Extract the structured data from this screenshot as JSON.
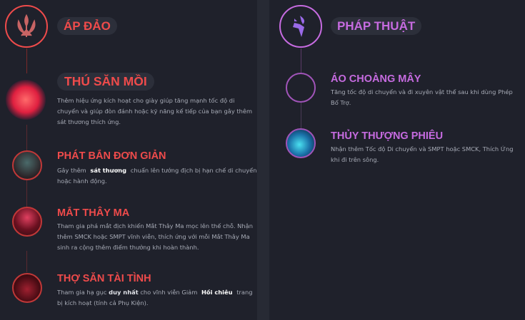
{
  "colors": {
    "domination": "#ef4b4b",
    "sorcery": "#c66be0",
    "text": "#a7abb6",
    "bg": "#1f212b"
  },
  "left": {
    "tree_name": "ÁP ĐẢO",
    "tree_icon": "domination-crest-icon",
    "keystone": {
      "name": "THÚ SĂN MỒI",
      "icon": "wolf-icon",
      "desc": "Thêm hiệu ứng kích hoạt cho giày giúp tăng mạnh tốc độ di chuyển và giúp đòn đánh hoặc kỹ năng kế tiếp của bạn gây thêm sát thương thích ứng."
    },
    "runes": [
      {
        "name": "PHÁT BẮN ĐƠN GIẢN",
        "icon": "cheap-shot-icon",
        "desc_a": "Gây thêm",
        "desc_b": "sát thương",
        "desc_c": "chuẩn lên tướng địch bị hạn chế di chuyển hoặc hành động."
      },
      {
        "name": "MẮT THÂY MA",
        "icon": "zombie-ward-icon",
        "desc": "Tham gia phá mắt địch khiến Mắt Thây Ma mọc lên thế chỗ. Nhận thêm SMCK hoặc SMPT vĩnh viễn, thích ứng với mỗi Mắt Thây Ma sinh ra cộng thêm điểm thưởng khi hoàn thành."
      },
      {
        "name": "THỢ SĂN TÀI TÌNH",
        "icon": "ingenious-hunter-icon",
        "desc_a": "Tham gia hạ gục",
        "desc_b": "duy nhất",
        "desc_c": "cho vĩnh viễn Giảm",
        "desc_d": "Hồi chiêu",
        "desc_e": "trang bị kích hoạt (tính cả Phụ Kiện)."
      }
    ]
  },
  "right": {
    "tree_name": "PHÁP THUẬT",
    "tree_icon": "sorcery-shard-icon",
    "runes": [
      {
        "name": "ÁO CHOÀNG MÂY",
        "icon": "nimbus-cloak-icon",
        "desc": "Tăng tốc độ di chuyển và đi xuyên vật thể sau khi dùng Phép Bổ Trợ."
      },
      {
        "name": "THỦY THƯỢNG PHIÊU",
        "icon": "waterwalking-icon",
        "desc": "Nhận thêm Tốc độ Di chuyển và SMPT hoặc SMCK, Thích Ứng khi đi trên sông."
      }
    ]
  }
}
